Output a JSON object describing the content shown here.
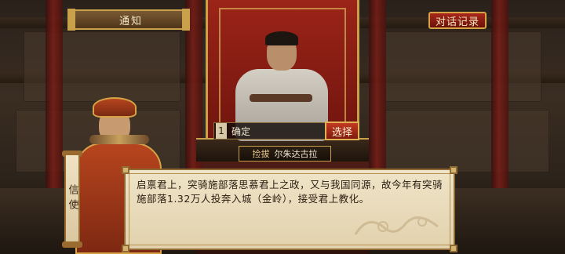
{
  "notice": {
    "label": "通知"
  },
  "dialog_log": {
    "label": "对话记录"
  },
  "choice": {
    "number": "1",
    "text": "确定",
    "select_label": "选择"
  },
  "nameplate": {
    "title": "捡拔",
    "name": "尔朱达古拉"
  },
  "speaker": {
    "label": "信使"
  },
  "dialogue": {
    "text": "启禀君上，突骑施部落思慕君上之政，又与我国同源，故今年有突骑施部落1.32万人投奔入城（金岭），接受君上教化。"
  },
  "colors": {
    "accent_red": "#a8281a",
    "gold": "#c9a14a",
    "parchment": "#efe4c8"
  }
}
